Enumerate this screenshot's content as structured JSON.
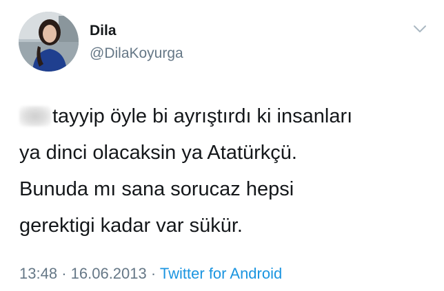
{
  "user": {
    "display_name": "Dila",
    "handle": "@DilaKoyurga"
  },
  "tweet": {
    "lines": [
      "tayyip öyle bi ayrıştırdı ki insanları",
      "ya dinci olacaksin ya Atatürkçü.",
      "Bunuda mı sana sorucaz hepsi",
      "gerektigi kadar var sükür."
    ]
  },
  "meta": {
    "time": "13:48",
    "separator": "·",
    "date": "16.06.2013",
    "source": "Twitter for Android"
  },
  "icons": {
    "menu": "chevron-down-icon",
    "redaction": "blurred-redaction"
  },
  "colors": {
    "text": "#14171a",
    "secondary": "#657786",
    "link": "#1b95e0",
    "background": "#ffffff"
  }
}
